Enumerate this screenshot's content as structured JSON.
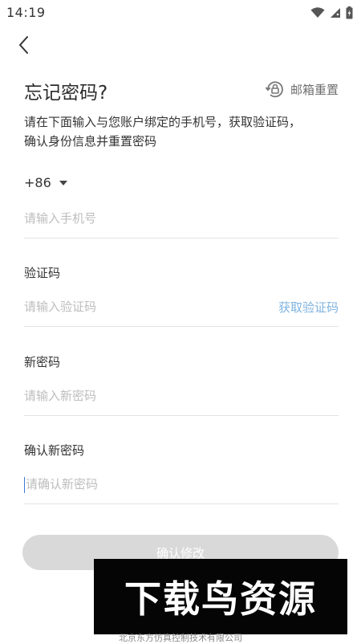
{
  "status_bar": {
    "time": "14:19",
    "icons": [
      "wifi-icon",
      "signal-icon",
      "battery-icon"
    ]
  },
  "nav": {
    "back_icon": "back-icon"
  },
  "header": {
    "title": "忘记密码?",
    "email_reset_label": "邮箱重置",
    "email_reset_icon": "lock-reset-icon"
  },
  "description": {
    "line1": "请在下面输入与您账户绑定的手机号，获取验证码，",
    "line2": "确认身份信息并重置密码"
  },
  "phone": {
    "country_code": "+86",
    "placeholder": "请输入手机号"
  },
  "verify": {
    "label": "验证码",
    "placeholder": "请输入验证码",
    "get_code_label": "获取验证码"
  },
  "new_password": {
    "label": "新密码",
    "placeholder": "请输入新密码"
  },
  "confirm_password": {
    "label": "确认新密码",
    "placeholder": "请确认新密码"
  },
  "submit": {
    "label": "确认修改"
  },
  "watermark": {
    "text": "下载鸟资源"
  },
  "footer": {
    "text": "北京东方仿真控制技术有限公司"
  },
  "colors": {
    "link": "#7fb3e0",
    "button_disabled": "#d9d9d9",
    "divider": "#e3e3e3"
  }
}
